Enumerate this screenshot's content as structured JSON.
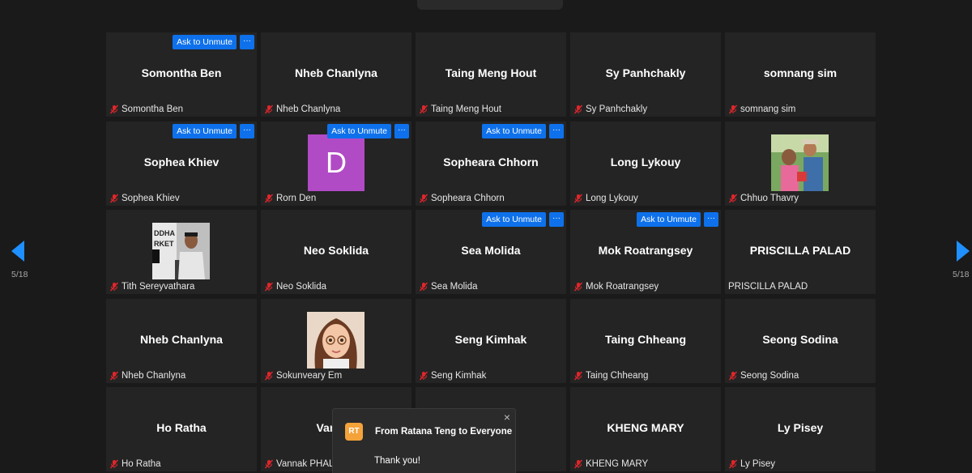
{
  "colors": {
    "background": "#1a1a1a",
    "tile": "#242424",
    "accent": "#0e71eb",
    "mic_muted": "#e0262b",
    "avatar_d": "#b14bc5",
    "chat_avatar": "#f4a23a"
  },
  "navigation": {
    "page_left": "5/18",
    "page_right": "5/18",
    "left_icon": "chevron-left-icon",
    "right_icon": "chevron-right-icon"
  },
  "unmute_label": "Ask to Unmute",
  "more_label": "···",
  "tiles": [
    {
      "center": "Somontha Ben",
      "footer": "Somontha Ben",
      "muted": true,
      "unmute": true,
      "media": "none"
    },
    {
      "center": "Nheb Chanlyna",
      "footer": "Nheb Chanlyna",
      "muted": true,
      "unmute": false,
      "media": "none"
    },
    {
      "center": "Taing Meng Hout",
      "footer": "Taing Meng Hout",
      "muted": true,
      "unmute": false,
      "media": "none"
    },
    {
      "center": "Sy Panhchakly",
      "footer": "Sy Panhchakly",
      "muted": true,
      "unmute": false,
      "media": "none"
    },
    {
      "center": "somnang sim",
      "footer": "somnang sim",
      "muted": true,
      "unmute": false,
      "media": "none"
    },
    {
      "center": "Sophea Khiev",
      "footer": "Sophea Khiev",
      "muted": true,
      "unmute": true,
      "media": "none"
    },
    {
      "center": "",
      "footer": "Rorn Den",
      "muted": true,
      "unmute": true,
      "media": "letter",
      "avatar_letter": "D"
    },
    {
      "center": "Sophearа Chhorn",
      "footer": "Sophearа Chhorn",
      "muted": true,
      "unmute": true,
      "media": "none"
    },
    {
      "center": "Long Lykouy",
      "footer": "Long Lykouy",
      "muted": true,
      "unmute": false,
      "media": "none"
    },
    {
      "center": "",
      "footer": "Chhuo Thavry",
      "muted": true,
      "unmute": false,
      "media": "photo-outdoor"
    },
    {
      "center": "",
      "footer": "Tith Sereyvathara",
      "muted": true,
      "unmute": false,
      "media": "photo-man"
    },
    {
      "center": "Neo Soklida",
      "footer": "Neo Soklida",
      "muted": true,
      "unmute": false,
      "media": "none"
    },
    {
      "center": "Sea Molida",
      "footer": "Sea Molida",
      "muted": true,
      "unmute": true,
      "media": "none"
    },
    {
      "center": "Mok Roatrangsey",
      "footer": "Mok Roatrangsey",
      "muted": true,
      "unmute": true,
      "media": "none"
    },
    {
      "center": "PRISCILLA PALAD",
      "footer": "PRISCILLA PALAD",
      "muted": false,
      "unmute": false,
      "media": "none"
    },
    {
      "center": "Nheb Chanlyna",
      "footer": "Nheb Chanlyna",
      "muted": true,
      "unmute": false,
      "media": "none"
    },
    {
      "center": "",
      "footer": "Sokunveary Em",
      "muted": true,
      "unmute": false,
      "media": "photo-cartoon"
    },
    {
      "center": "Seng Kimhak",
      "footer": "Seng Kimhak",
      "muted": true,
      "unmute": false,
      "media": "none"
    },
    {
      "center": "Taing Chheang",
      "footer": "Taing Chheang",
      "muted": true,
      "unmute": false,
      "media": "none"
    },
    {
      "center": "Seong Sodina",
      "footer": "Seong Sodina",
      "muted": true,
      "unmute": false,
      "media": "none"
    },
    {
      "center": "Ho Ratha",
      "footer": "Ho Ratha",
      "muted": true,
      "unmute": false,
      "media": "none"
    },
    {
      "center": "Vannak",
      "footer": "Vannak PHAL",
      "muted": true,
      "unmute": false,
      "media": "none"
    },
    {
      "center": "",
      "footer": "",
      "muted": false,
      "unmute": false,
      "media": "none"
    },
    {
      "center": "KHENG MARY",
      "footer": "KHENG MARY",
      "muted": true,
      "unmute": false,
      "media": "none"
    },
    {
      "center": "Ly Pisey",
      "footer": "Ly Pisey",
      "muted": true,
      "unmute": false,
      "media": "none"
    }
  ],
  "chat": {
    "avatar_initials": "RT",
    "title": "From Ratana Teng to Everyone",
    "message": "Thank you!",
    "close": "×"
  }
}
